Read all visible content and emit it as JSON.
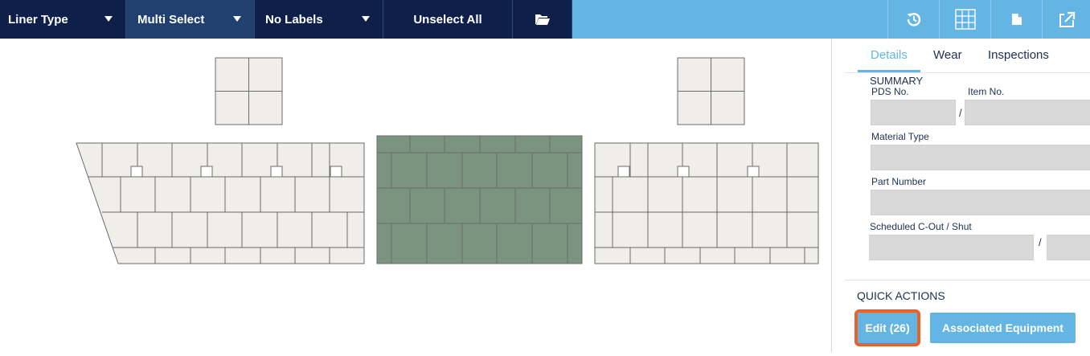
{
  "toolbar": {
    "liner_type": "Liner Type",
    "multi_select": "Multi Select",
    "labels": "No Labels",
    "unselect_all": "Unselect All",
    "icons": [
      "folder-open-icon",
      "history-icon",
      "grid-icon",
      "document-icon",
      "export-icon"
    ],
    "colors": {
      "dark": "#0e1f49",
      "selected": "#20406f",
      "accent": "#64b5e3"
    }
  },
  "canvas": {
    "tile_color": "#efeeeb",
    "selected_tile_color": "#7a9480",
    "line_color": "#6b6b6b"
  },
  "panel": {
    "tabs": [
      {
        "label": "Details",
        "active": true
      },
      {
        "label": "Wear",
        "active": false
      },
      {
        "label": "Inspections",
        "active": false
      }
    ],
    "summary_title": "SUMMARY",
    "fields": {
      "pds_no": {
        "label": "PDS No.",
        "value": ""
      },
      "item_no": {
        "label": "Item No.",
        "value": ""
      },
      "material_type": {
        "label": "Material Type",
        "value": ""
      },
      "part_number": {
        "label": "Part Number",
        "value": ""
      },
      "scheduled": {
        "label": "Scheduled C-Out / Shut",
        "value": ""
      }
    },
    "separator": "/",
    "quick_actions_title": "QUICK ACTIONS",
    "edit_label": "Edit (26)",
    "associated_label": "Associated Equipment",
    "highlight_color": "#e8622c"
  }
}
